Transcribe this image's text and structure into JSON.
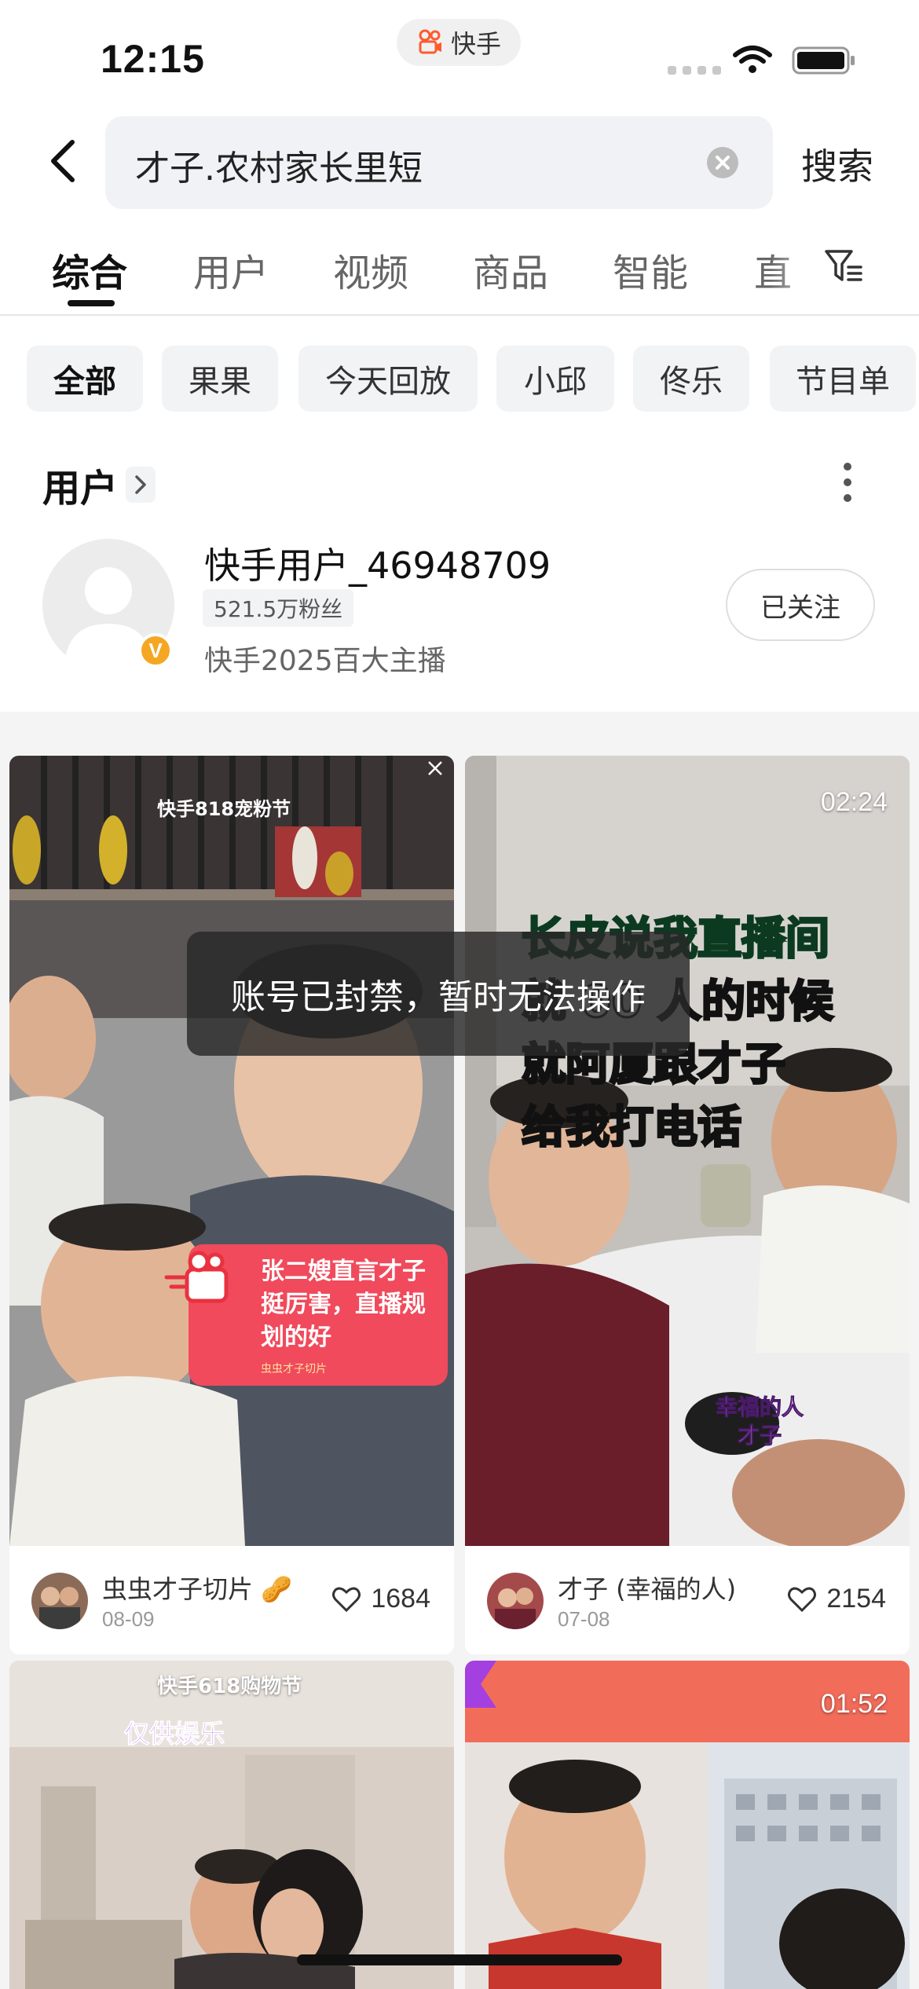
{
  "status_bar": {
    "time": "12:15",
    "app_name": "快手",
    "app_icon": "kuaishou-logo-icon"
  },
  "search": {
    "query": "才子.农村家长里短",
    "submit_label": "搜索"
  },
  "tabs": [
    {
      "label": "综合",
      "active": true
    },
    {
      "label": "用户",
      "active": false
    },
    {
      "label": "视频",
      "active": false
    },
    {
      "label": "商品",
      "active": false
    },
    {
      "label": "智能",
      "active": false
    },
    {
      "label": "直",
      "active": false
    }
  ],
  "chips": [
    {
      "label": "全部",
      "active": true
    },
    {
      "label": "果果",
      "active": false
    },
    {
      "label": "今天回放",
      "active": false
    },
    {
      "label": "小邱",
      "active": false
    },
    {
      "label": "佟乐",
      "active": false
    },
    {
      "label": "节目单",
      "active": false
    }
  ],
  "users_section": {
    "title": "用户",
    "user": {
      "name": "快手用户_46948709",
      "fans": "521.5万粉丝",
      "description": "快手2025百大主播",
      "verified_mark": "V",
      "follow_label": "已关注"
    }
  },
  "toast": {
    "message": "账号已封禁，暂时无法操作"
  },
  "cards": [
    {
      "author": "虫虫才子切片",
      "date": "08-09",
      "likes": "1684",
      "banner": "快手818宠粉节",
      "bubble_text": "张二嫂直言才子挺厉害，直播规划的好",
      "bubble_sub": "虫虫才子切片"
    },
    {
      "author": "才子 (幸福的人)",
      "date": "07-08",
      "likes": "2154",
      "duration": "02:24",
      "caption_lines": [
        "长皮说我直播间",
        "就 00 人的时候",
        "就阿厦跟才子",
        "给我打电话"
      ],
      "tag": "幸福的人\n才子"
    },
    {
      "banner": "快手618购物节",
      "label": "仅供娱乐"
    },
    {
      "duration": "01:52"
    }
  ],
  "colors": {
    "accent_orange": "#fe3666",
    "caption_green": "#35e08a",
    "caption_yellow": "#f6e82a",
    "bubble_red": "#f04a5c"
  }
}
